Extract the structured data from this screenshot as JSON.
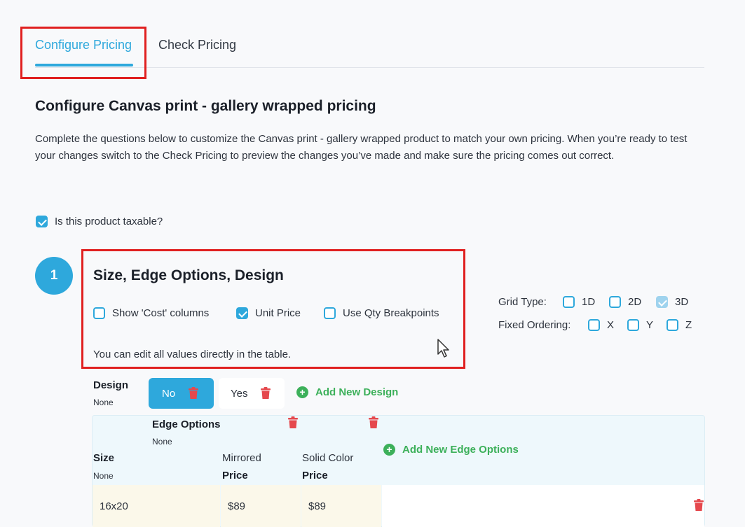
{
  "tabs": [
    {
      "label": "Configure Pricing",
      "active": true
    },
    {
      "label": "Check Pricing",
      "active": false
    }
  ],
  "page": {
    "title": "Configure Canvas print - gallery wrapped pricing",
    "intro": "Complete the questions below to customize the Canvas print - gallery wrapped product to match your own pricing. When you’re ready to test your changes switch to the Check Pricing to preview the changes you’ve made and make sure the pricing comes out correct."
  },
  "taxable": {
    "label": "Is this product taxable?",
    "checked": true
  },
  "section": {
    "step": "1",
    "title": "Size, Edge Options, Design",
    "options": [
      {
        "label": "Show 'Cost' columns",
        "checked": false
      },
      {
        "label": "Unit Price",
        "checked": true
      },
      {
        "label": "Use Qty Breakpoints",
        "checked": false
      }
    ],
    "hint": "You can edit all values directly in the table."
  },
  "grid": {
    "type_label": "Grid Type:",
    "type_options": [
      {
        "label": "1D",
        "checked": false
      },
      {
        "label": "2D",
        "checked": false
      },
      {
        "label": "3D",
        "checked": true
      }
    ],
    "ordering_label": "Fixed Ordering:",
    "ordering_options": [
      {
        "label": "X",
        "checked": false
      },
      {
        "label": "Y",
        "checked": false
      },
      {
        "label": "Z",
        "checked": false
      }
    ]
  },
  "design": {
    "label": "Design",
    "sub": "None",
    "values": [
      "No",
      "Yes"
    ],
    "selected": "No",
    "add_label": "Add New Design"
  },
  "edge": {
    "label": "Edge Options",
    "sub": "None",
    "add_label": "Add New Edge Options"
  },
  "table": {
    "size_label": "Size",
    "size_sub": "None",
    "columns": [
      {
        "name": "Mirrored",
        "sub": "Price"
      },
      {
        "name": "Solid Color",
        "sub": "Price"
      }
    ],
    "rows": [
      {
        "size": "16x20",
        "values": [
          "$89",
          "$89"
        ]
      }
    ]
  },
  "colors": {
    "accent": "#2ea8dc",
    "add_green": "#3cb05a",
    "delete_red": "#e5484d",
    "highlight": "#e02020"
  },
  "icons": {
    "delete": "trash-icon",
    "add": "plus-circle-icon",
    "pointer": "mouse-cursor-icon"
  }
}
